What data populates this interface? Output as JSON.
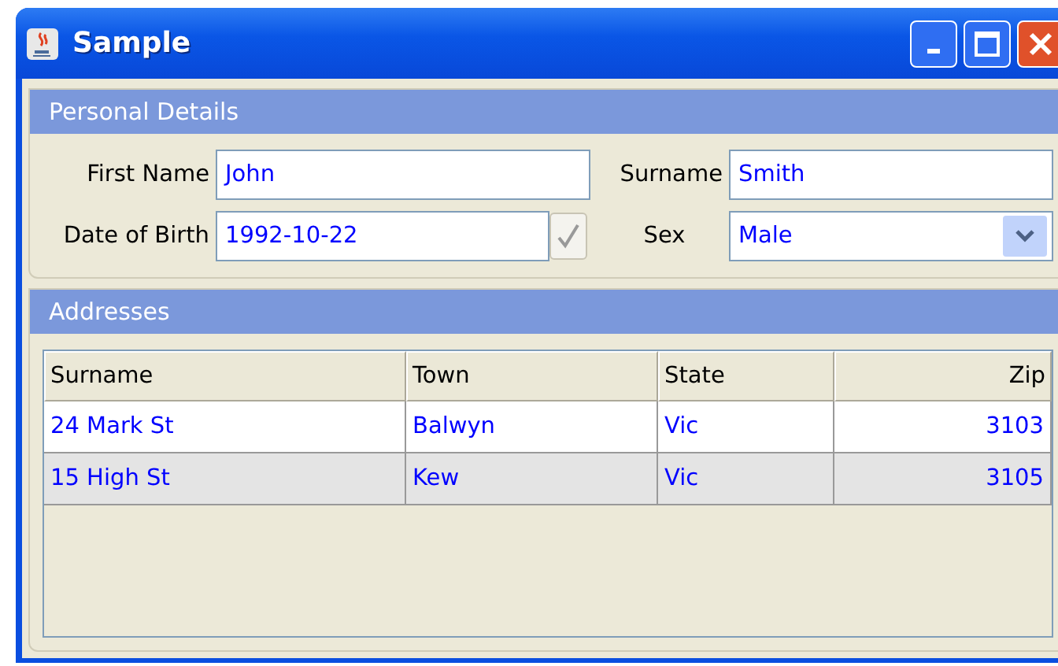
{
  "window": {
    "title": "Sample"
  },
  "personal_details": {
    "title": "Personal Details",
    "first_name": {
      "label": "First Name",
      "value": "John"
    },
    "surname": {
      "label": "Surname",
      "value": "Smith"
    },
    "date_of_birth": {
      "label": "Date of Birth",
      "value": "1992-10-22",
      "checked": true
    },
    "sex": {
      "label": "Sex",
      "value": "Male"
    }
  },
  "addresses": {
    "title": "Addresses",
    "table": {
      "columns": [
        {
          "label": "Surname",
          "align_right": false
        },
        {
          "label": "Town",
          "align_right": false
        },
        {
          "label": "State",
          "align_right": false
        },
        {
          "label": "Zip",
          "align_right": true
        }
      ],
      "rows": [
        [
          "24 Mark St",
          "Balwyn",
          "Vic",
          "3103"
        ],
        [
          "15 High St",
          "Kew",
          "Vic",
          "3105"
        ]
      ]
    }
  }
}
